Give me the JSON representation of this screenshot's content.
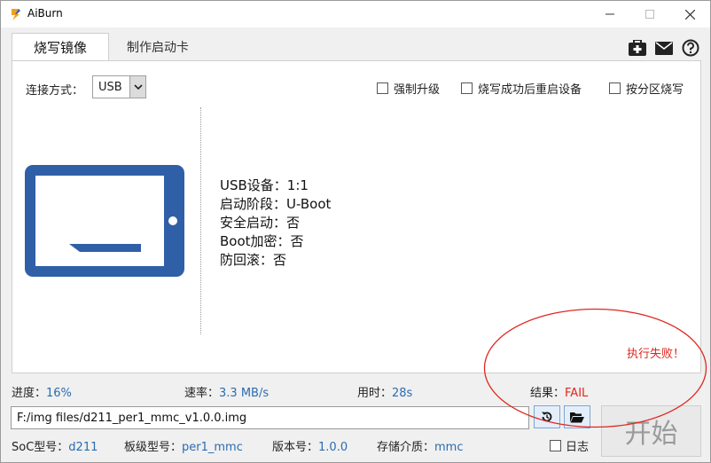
{
  "window": {
    "title": "AiBurn",
    "controls": {
      "minimize": "—",
      "maximize": "☐",
      "close": "✕"
    }
  },
  "tabs": [
    {
      "label": "烧写镜像",
      "active": true
    },
    {
      "label": "制作启动卡",
      "active": false
    }
  ],
  "toolbar_icons": [
    "medkit-icon",
    "mail-icon",
    "help-icon"
  ],
  "connection": {
    "label": "连接方式：",
    "value": "USB"
  },
  "options": [
    {
      "label": "强制升级",
      "checked": false
    },
    {
      "label": "烧写成功后重启设备",
      "checked": false
    },
    {
      "label": "按分区烧写",
      "checked": false
    }
  ],
  "device_info": {
    "usb": "USB设备：1:1",
    "stage": "启动阶段：U-Boot",
    "secure_boot": "安全启动：否",
    "boot_encrypt": "Boot加密：否",
    "anti_rollback": "防回滚：否"
  },
  "message": "执行失败！",
  "status": {
    "progress_label": "进度：",
    "progress_value": "16%",
    "speed_label": "速率：",
    "speed_value": "3.3 MB/s",
    "time_label": "用时：",
    "time_value": "28s",
    "result_label": "结果：",
    "result_value": "FAIL"
  },
  "file_path": "F:/img files/d211_per1_mmc_v1.0.0.img",
  "start_button": "开始",
  "footer": {
    "soc_label": "SoC型号：",
    "soc_value": "d211",
    "board_label": "板级型号：",
    "board_value": "per1_mmc",
    "version_label": "版本号：",
    "version_value": "1.0.0",
    "storage_label": "存储介质：",
    "storage_value": "mmc",
    "log_label": "日志"
  },
  "colors": {
    "accent_blue": "#2f5fa7",
    "fail_red": "#e0261f",
    "value_blue": "#2b6cb0"
  }
}
